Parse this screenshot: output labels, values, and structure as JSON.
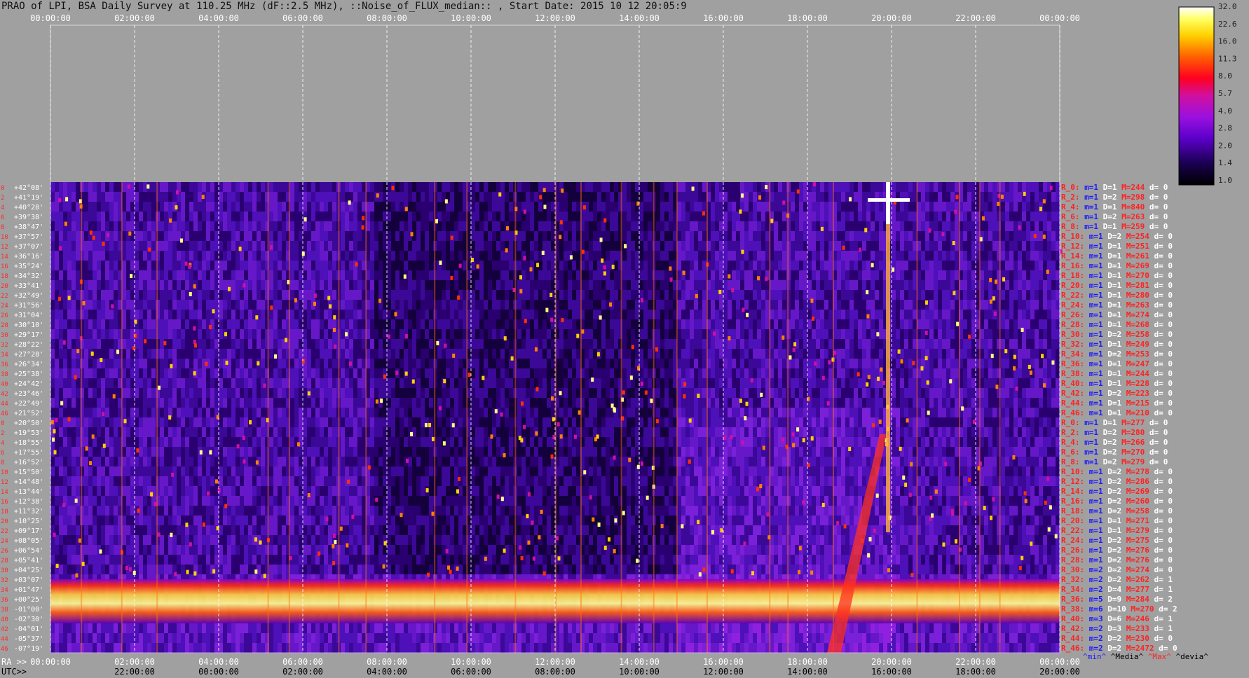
{
  "title": "PRAO of LPI, BSA Daily Survey at 110.25 MHz (dF::2.5 MHz), ::Noise_of_FLUX_median:: , Start Date: 2015 10 12 20:05:9",
  "chart_data": {
    "type": "heatmap",
    "title": "PRAO of LPI, BSA Daily Survey at 110.25 MHz (dF::2.5 MHz), ::Noise_of_FLUX_median:: , Start Date: 2015 10 12 20:05:9",
    "x_top_ticks": [
      "00:00:00",
      "02:00:00",
      "04:00:00",
      "06:00:00",
      "08:00:00",
      "10:00:00",
      "12:00:00",
      "14:00:00",
      "16:00:00",
      "18:00:00",
      "20:00:00",
      "22:00:00",
      "00:00:00"
    ],
    "x_bottom_ra_prefix": "RA >>",
    "x_bottom_ra_ticks": [
      "00:00:00",
      "02:00:00",
      "04:00:00",
      "06:00:00",
      "08:00:00",
      "10:00:00",
      "12:00:00",
      "14:00:00",
      "16:00:00",
      "18:00:00",
      "20:00:00",
      "22:00:00",
      "00:00:00"
    ],
    "x_bottom_utc_prefix": "UTC>>",
    "x_bottom_utc_ticks": [
      "22:00:00",
      "00:00:00",
      "02:00:00",
      "04:00:00",
      "06:00:00",
      "08:00:00",
      "10:00:00",
      "12:00:00",
      "14:00:00",
      "16:00:00",
      "18:00:00",
      "20:00:00"
    ],
    "dec_labels": [
      "+42°08'",
      "+41°19'",
      "+40°28'",
      "+39°38'",
      "+38°47'",
      "+37°57'",
      "+37°07'",
      "+36°16'",
      "+35°24'",
      "+34°32'",
      "+33°41'",
      "+32°49'",
      "+31°56'",
      "+31°04'",
      "+30°10'",
      "+29°17'",
      "+28°22'",
      "+27°28'",
      "+26°34'",
      "+25°38'",
      "+24°42'",
      "+23°46'",
      "+22°49'",
      "+21°52'",
      "+20°50'",
      "+19°53'",
      "+18°55'",
      "+17°55'",
      "+16°52'",
      "+15°50'",
      "+14°48'",
      "+13°44'",
      "+12°38'",
      "+11°32'",
      "+10°25'",
      "+09°17'",
      "+08°05'",
      "+06°54'",
      "+05°41'",
      "+04°25'",
      "+03°07'",
      "+01°47'",
      "+00°25'",
      "-01°00'",
      "-02°30'",
      "-04°01'",
      "-05°37'",
      "-07°19'"
    ],
    "row_numbers": [
      "0",
      "2",
      "4",
      "6",
      "8",
      "10",
      "12",
      "14",
      "16",
      "18",
      "20",
      "22",
      "24",
      "26",
      "28",
      "30",
      "32",
      "34",
      "36",
      "38",
      "40",
      "42",
      "44",
      "46",
      "0",
      "2",
      "4",
      "6",
      "8",
      "10",
      "12",
      "14",
      "16",
      "18",
      "20",
      "22",
      "24",
      "26",
      "28",
      "30",
      "32",
      "34",
      "36",
      "38",
      "40",
      "42",
      "44",
      "46"
    ],
    "colorbar_labels": [
      "32.0",
      "22.6",
      "16.0",
      "11.3",
      "8.0",
      "5.7",
      "4.0",
      "2.8",
      "2.0",
      "1.4",
      "1.0"
    ],
    "stats": [
      {
        "r": "R_0:",
        "min": "m=1",
        "med": "D=1",
        "max": "M=244",
        "dev": "d= 0"
      },
      {
        "r": "R_2:",
        "min": "m=1",
        "med": "D=2",
        "max": "M=298",
        "dev": "d= 0"
      },
      {
        "r": "R_4:",
        "min": "m=1",
        "med": "D=1",
        "max": "M=840",
        "dev": "d= 0"
      },
      {
        "r": "R_6:",
        "min": "m=1",
        "med": "D=2",
        "max": "M=263",
        "dev": "d= 0"
      },
      {
        "r": "R_8:",
        "min": "m=1",
        "med": "D=1",
        "max": "M=259",
        "dev": "d= 0"
      },
      {
        "r": "R_10:",
        "min": "m=1",
        "med": "D=2",
        "max": "M=254",
        "dev": "d= 0"
      },
      {
        "r": "R_12:",
        "min": "m=1",
        "med": "D=1",
        "max": "M=251",
        "dev": "d= 0"
      },
      {
        "r": "R_14:",
        "min": "m=1",
        "med": "D=1",
        "max": "M=261",
        "dev": "d= 0"
      },
      {
        "r": "R_16:",
        "min": "m=1",
        "med": "D=1",
        "max": "M=269",
        "dev": "d= 0"
      },
      {
        "r": "R_18:",
        "min": "m=1",
        "med": "D=1",
        "max": "M=270",
        "dev": "d= 0"
      },
      {
        "r": "R_20:",
        "min": "m=1",
        "med": "D=1",
        "max": "M=281",
        "dev": "d= 0"
      },
      {
        "r": "R_22:",
        "min": "m=1",
        "med": "D=1",
        "max": "M=280",
        "dev": "d= 0"
      },
      {
        "r": "R_24:",
        "min": "m=1",
        "med": "D=1",
        "max": "M=263",
        "dev": "d= 0"
      },
      {
        "r": "R_26:",
        "min": "m=1",
        "med": "D=1",
        "max": "M=274",
        "dev": "d= 0"
      },
      {
        "r": "R_28:",
        "min": "m=1",
        "med": "D=1",
        "max": "M=268",
        "dev": "d= 0"
      },
      {
        "r": "R_30:",
        "min": "m=1",
        "med": "D=2",
        "max": "M=258",
        "dev": "d= 0"
      },
      {
        "r": "R_32:",
        "min": "m=1",
        "med": "D=1",
        "max": "M=249",
        "dev": "d= 0"
      },
      {
        "r": "R_34:",
        "min": "m=1",
        "med": "D=2",
        "max": "M=253",
        "dev": "d= 0"
      },
      {
        "r": "R_36:",
        "min": "m=1",
        "med": "D=1",
        "max": "M=247",
        "dev": "d= 0"
      },
      {
        "r": "R_38:",
        "min": "m=1",
        "med": "D=1",
        "max": "M=244",
        "dev": "d= 0"
      },
      {
        "r": "R_40:",
        "min": "m=1",
        "med": "D=1",
        "max": "M=228",
        "dev": "d= 0"
      },
      {
        "r": "R_42:",
        "min": "m=1",
        "med": "D=2",
        "max": "M=223",
        "dev": "d= 0"
      },
      {
        "r": "R_44:",
        "min": "m=1",
        "med": "D=1",
        "max": "M=215",
        "dev": "d= 0"
      },
      {
        "r": "R_46:",
        "min": "m=1",
        "med": "D=1",
        "max": "M=210",
        "dev": "d= 0"
      },
      {
        "r": "R_0:",
        "min": "m=1",
        "med": "D=1",
        "max": "M=277",
        "dev": "d= 0"
      },
      {
        "r": "R_2:",
        "min": "m=1",
        "med": "D=2",
        "max": "M=280",
        "dev": "d= 0"
      },
      {
        "r": "R_4:",
        "min": "m=1",
        "med": "D=2",
        "max": "M=266",
        "dev": "d= 0"
      },
      {
        "r": "R_6:",
        "min": "m=1",
        "med": "D=2",
        "max": "M=270",
        "dev": "d= 0"
      },
      {
        "r": "R_8:",
        "min": "m=1",
        "med": "D=2",
        "max": "M=279",
        "dev": "d= 0"
      },
      {
        "r": "R_10:",
        "min": "m=1",
        "med": "D=2",
        "max": "M=278",
        "dev": "d= 0"
      },
      {
        "r": "R_12:",
        "min": "m=1",
        "med": "D=2",
        "max": "M=286",
        "dev": "d= 0"
      },
      {
        "r": "R_14:",
        "min": "m=1",
        "med": "D=2",
        "max": "M=269",
        "dev": "d= 0"
      },
      {
        "r": "R_16:",
        "min": "m=1",
        "med": "D=2",
        "max": "M=260",
        "dev": "d= 0"
      },
      {
        "r": "R_18:",
        "min": "m=1",
        "med": "D=2",
        "max": "M=258",
        "dev": "d= 0"
      },
      {
        "r": "R_20:",
        "min": "m=1",
        "med": "D=1",
        "max": "M=271",
        "dev": "d= 0"
      },
      {
        "r": "R_22:",
        "min": "m=1",
        "med": "D=1",
        "max": "M=279",
        "dev": "d= 0"
      },
      {
        "r": "R_24:",
        "min": "m=1",
        "med": "D=2",
        "max": "M=275",
        "dev": "d= 0"
      },
      {
        "r": "R_26:",
        "min": "m=1",
        "med": "D=2",
        "max": "M=276",
        "dev": "d= 0"
      },
      {
        "r": "R_28:",
        "min": "m=1",
        "med": "D=2",
        "max": "M=276",
        "dev": "d= 0"
      },
      {
        "r": "R_30:",
        "min": "m=2",
        "med": "D=2",
        "max": "M=274",
        "dev": "d= 0"
      },
      {
        "r": "R_32:",
        "min": "m=2",
        "med": "D=2",
        "max": "M=262",
        "dev": "d= 1"
      },
      {
        "r": "R_34:",
        "min": "m=2",
        "med": "D=4",
        "max": "M=277",
        "dev": "d= 1"
      },
      {
        "r": "R_36:",
        "min": "m=5",
        "med": "D=9",
        "max": "M=284",
        "dev": "d= 2"
      },
      {
        "r": "R_38:",
        "min": "m=6",
        "med": "D=10",
        "max": "M=270",
        "dev": "d= 2"
      },
      {
        "r": "R_40:",
        "min": "m=3",
        "med": "D=6",
        "max": "M=246",
        "dev": "d= 1"
      },
      {
        "r": "R_42:",
        "min": "m=2",
        "med": "D=3",
        "max": "M=233",
        "dev": "d= 1"
      },
      {
        "r": "R_44:",
        "min": "m=2",
        "med": "D=2",
        "max": "M=230",
        "dev": "d= 0"
      },
      {
        "r": "R_46:",
        "min": "m=2",
        "med": "D=2",
        "max": "M=2472",
        "dev": "d= 0"
      }
    ],
    "stats_legend": {
      "min": "^min^",
      "med": "^Media^",
      "max": "^Max^",
      "dev": "^devia^"
    },
    "colors": {
      "background": "#a0a0a0",
      "min_text": "#1a1aff",
      "stat_text": "#ffffff",
      "max_text": "#ff2222",
      "label_red": "#ff2a2a"
    }
  }
}
